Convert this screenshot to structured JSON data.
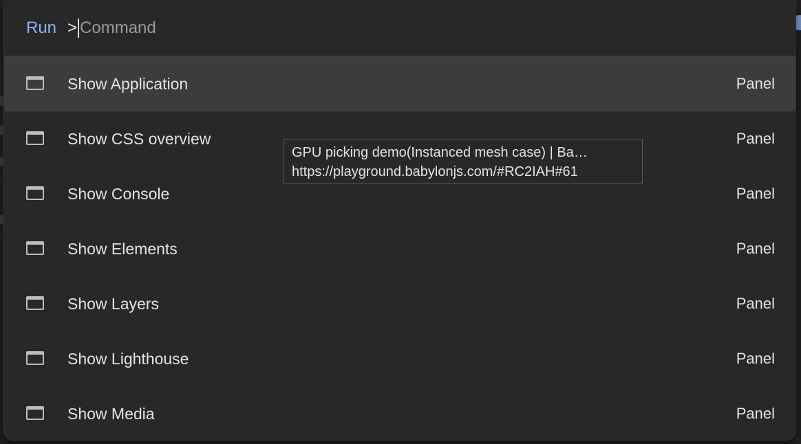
{
  "prompt": {
    "label": "Run",
    "prefix": ">",
    "placeholder": "Command"
  },
  "commands": [
    {
      "label": "Show Application",
      "category": "Panel",
      "selected": true,
      "icon": "panel-window-icon"
    },
    {
      "label": "Show CSS overview",
      "category": "Panel",
      "selected": false,
      "icon": "panel-window-icon"
    },
    {
      "label": "Show Console",
      "category": "Panel",
      "selected": false,
      "icon": "panel-window-icon"
    },
    {
      "label": "Show Elements",
      "category": "Panel",
      "selected": false,
      "icon": "panel-window-icon"
    },
    {
      "label": "Show Layers",
      "category": "Panel",
      "selected": false,
      "icon": "panel-window-icon"
    },
    {
      "label": "Show Lighthouse",
      "category": "Panel",
      "selected": false,
      "icon": "panel-window-icon"
    },
    {
      "label": "Show Media",
      "category": "Panel",
      "selected": false,
      "icon": "panel-window-icon"
    }
  ],
  "tooltip": {
    "title": "GPU picking demo(Instanced mesh case) | Ba…",
    "url": "https://playground.babylonjs.com/#RC2IAH#61"
  },
  "colors": {
    "accent": "#8ab4f8",
    "palette_bg": "#282828",
    "selected_bg": "#3c3c3c",
    "text": "#e3e3e3"
  }
}
